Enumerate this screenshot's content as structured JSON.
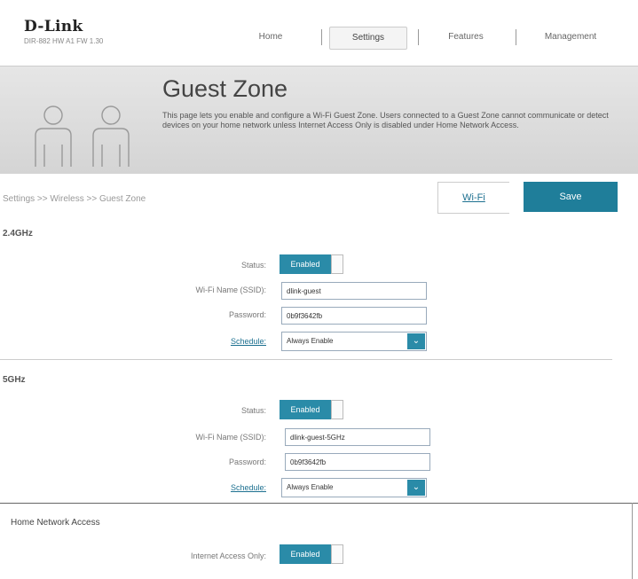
{
  "brand": {
    "logo_text": "D-Link",
    "model": "DIR-882 HW A1 FW 1.30"
  },
  "nav": {
    "items": [
      "Home",
      "Settings",
      "Features",
      "Management"
    ],
    "active": "Settings"
  },
  "hero": {
    "title": "Guest Zone",
    "description": "This page lets you enable and configure a Wi-Fi Guest Zone. Users connected to a Guest Zone cannot communicate or detect devices on your home network unless Internet Access Only is disabled under Home Network Access.",
    "icon": "users-icon"
  },
  "actionbar": {
    "breadcrumb": "Settings >> Wireless >> Guest Zone",
    "wifi_link": "Wi-Fi",
    "save_label": "Save"
  },
  "band24": {
    "title": "2.4GHz",
    "status_label": "Status:",
    "status_value": "Enabled",
    "ssid_label": "Wi-Fi Name (SSID):",
    "ssid_value": "dlink-guest",
    "password_label": "Password:",
    "password_value": "0b9f3642fb",
    "schedule_label": "Schedule:",
    "schedule_value": "Always Enable"
  },
  "band5": {
    "title": "5GHz",
    "status_label": "Status:",
    "status_value": "Enabled",
    "ssid_label": "Wi-Fi Name (SSID):",
    "ssid_value": "dlink-guest-5GHz",
    "password_label": "Password:",
    "password_value": "0b9f3642fb",
    "schedule_label": "Schedule:",
    "schedule_value": "Always Enable"
  },
  "home_network": {
    "title": "Home Network Access",
    "internet_only_label": "Internet Access Only:",
    "internet_only_value": "Enabled"
  },
  "colors": {
    "accent": "#1f7e9a",
    "toggle": "#2a8ba8",
    "link": "#1d7090"
  }
}
